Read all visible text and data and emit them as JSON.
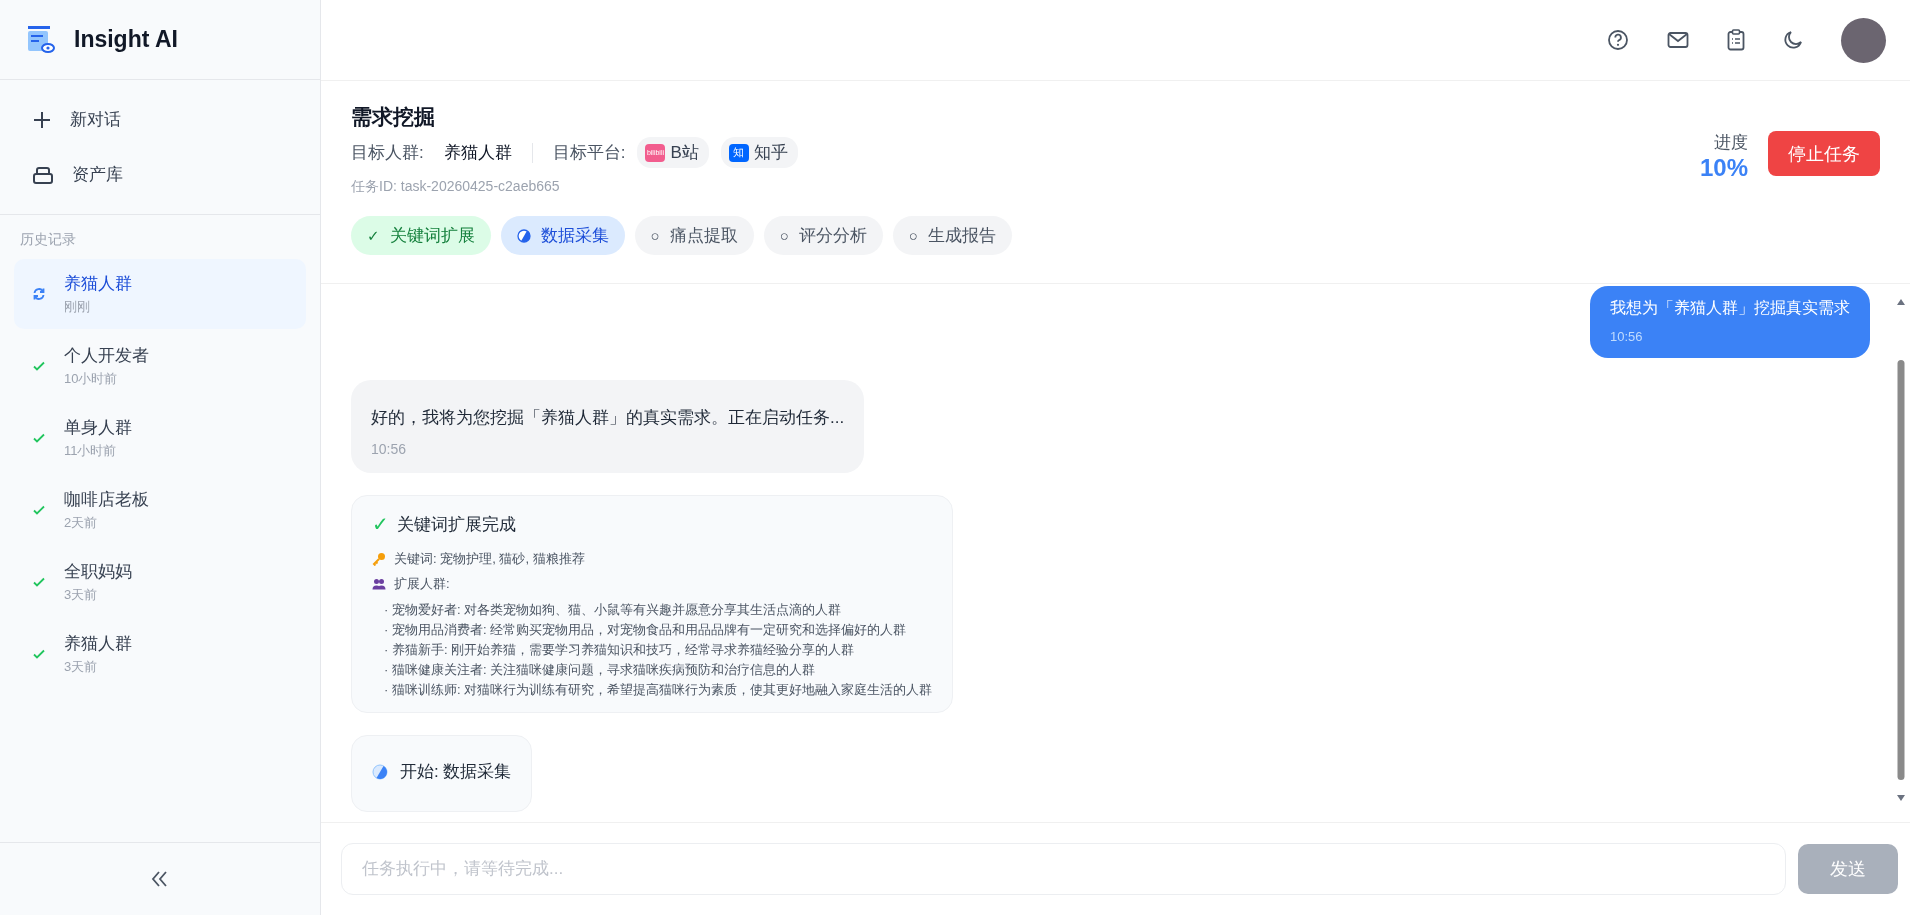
{
  "app": {
    "name": "Insight AI"
  },
  "sidebar": {
    "actions": [
      {
        "kind": "new",
        "label": "新对话"
      },
      {
        "kind": "assets",
        "label": "资产库"
      }
    ],
    "history_heading": "历史记录",
    "history": [
      {
        "title": "养猫人群",
        "time": "刚刚",
        "kind": "running",
        "selected": true
      },
      {
        "title": "个人开发者",
        "time": "10小时前",
        "kind": "done",
        "selected": false
      },
      {
        "title": "单身人群",
        "time": "11小时前",
        "kind": "done",
        "selected": false
      },
      {
        "title": "咖啡店老板",
        "time": "2天前",
        "kind": "done",
        "selected": false
      },
      {
        "title": "全职妈妈",
        "time": "3天前",
        "kind": "done",
        "selected": false
      },
      {
        "title": "养猫人群",
        "time": "3天前",
        "kind": "done",
        "selected": false
      }
    ]
  },
  "task": {
    "title": "需求挖掘",
    "audience_label": "目标人群:",
    "audience": "养猫人群",
    "platform_label": "目标平台:",
    "platforms": [
      {
        "kind": "bilibili",
        "name": "B站",
        "icon_text": "bilibili"
      },
      {
        "kind": "zhihu",
        "name": "知乎",
        "icon_text": "知"
      }
    ],
    "task_id": "任务ID: task-20260425-c2aeb665",
    "progress_label": "进度",
    "progress": "10%",
    "stop_button": "停止任务",
    "steps": [
      {
        "label": "关键词扩展",
        "kind": "done",
        "icon": "✓"
      },
      {
        "label": "数据采集",
        "kind": "active"
      },
      {
        "label": "痛点提取",
        "kind": "pending",
        "icon": "○"
      },
      {
        "label": "评分分析",
        "kind": "pending",
        "icon": "○"
      },
      {
        "label": "生成报告",
        "kind": "pending",
        "icon": "○"
      }
    ]
  },
  "messages": [
    {
      "kind": "user",
      "text": "我想为「养猫人群」挖掘真实需求",
      "time": "10:56"
    },
    {
      "kind": "assistant",
      "text": "好的，我将为您挖掘「养猫人群」的真实需求。正在启动任务...",
      "time": "10:56"
    },
    {
      "kind": "result",
      "title": "关键词扩展完成",
      "keywords": "关键词: 宠物护理, 猫砂, 猫粮推荐",
      "groups_label": "扩展人群:",
      "groups": [
        "· 宠物爱好者: 对各类宠物如狗、猫、小鼠等有兴趣并愿意分享其生活点滴的人群",
        "· 宠物用品消费者: 经常购买宠物用品，对宠物食品和用品品牌有一定研究和选择偏好的人群",
        "· 养猫新手: 刚开始养猫，需要学习养猫知识和技巧，经常寻求养猫经验分享的人群",
        "· 猫咪健康关注者: 关注猫咪健康问题，寻求猫咪疾病预防和治疗信息的人群",
        "· 猫咪训练师: 对猫咪行为训练有研究，希望提高猫咪行为素质，使其更好地融入家庭生活的人群"
      ]
    },
    {
      "kind": "status",
      "text": "开始: 数据采集"
    }
  ],
  "composer": {
    "placeholder": "任务执行中，请等待完成...",
    "send": "发送",
    "disabled": true
  }
}
